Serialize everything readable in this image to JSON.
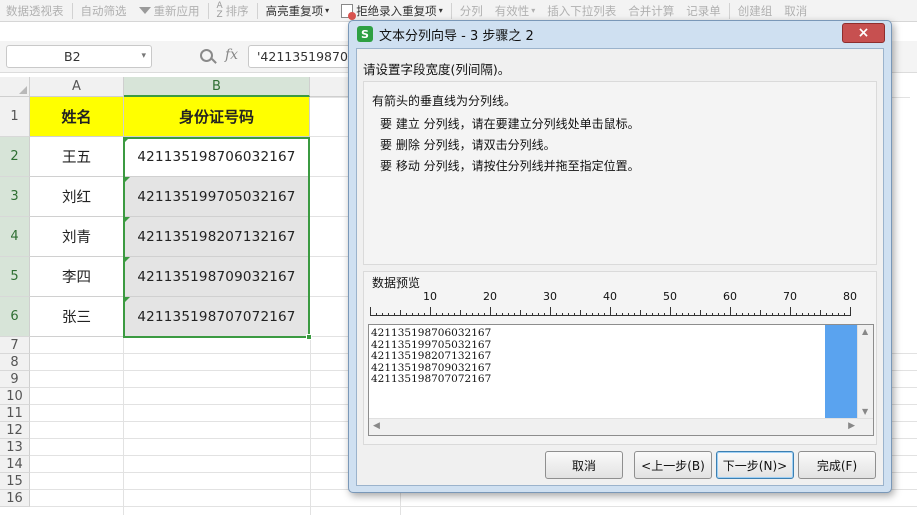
{
  "ribbon": {
    "items": [
      {
        "label": "数据透视表",
        "enabled": false
      },
      {
        "label": "自动筛选",
        "enabled": false
      },
      {
        "label": "重新应用",
        "enabled": false
      },
      {
        "label": "排序",
        "enabled": false
      },
      {
        "label": "高亮重复项",
        "enabled": true
      },
      {
        "label": "拒绝录入重复项",
        "enabled": true
      },
      {
        "label": "分列",
        "enabled": false
      },
      {
        "label": "有效性",
        "enabled": false
      },
      {
        "label": "插入下拉列表",
        "enabled": false
      },
      {
        "label": "合并计算",
        "enabled": false
      },
      {
        "label": "记录单",
        "enabled": false
      },
      {
        "label": "创建组",
        "enabled": false
      },
      {
        "label": "取消",
        "enabled": false
      }
    ]
  },
  "formula_bar": {
    "name_box": "B2",
    "fx": "fx",
    "value": "'42113519870"
  },
  "sheet": {
    "columns": [
      "A",
      "B"
    ],
    "selected_column": "B",
    "rows": [
      "1",
      "2",
      "3",
      "4",
      "5",
      "6",
      "7",
      "8",
      "9",
      "10",
      "11",
      "12",
      "13",
      "14",
      "15",
      "16"
    ],
    "header_name": "姓名",
    "header_id": "身份证号码",
    "records": [
      {
        "name": "王五",
        "id": "421135198706032167"
      },
      {
        "name": "刘红",
        "id": "421135199705032167"
      },
      {
        "name": "刘青",
        "id": "421135198207132167"
      },
      {
        "name": "李四",
        "id": "421135198709032167"
      },
      {
        "name": "张三",
        "id": "421135198707072167"
      }
    ]
  },
  "dialog": {
    "icon_letter": "S",
    "title": "文本分列向导 - 3 步骤之 2",
    "close": "×",
    "prompt": "请设置字段宽度(列间隔)。",
    "instructions": [
      "有箭头的垂直线为分列线。",
      "要 建立 分列线，请在要建立分列线处单击鼠标。",
      "要 删除 分列线，请双击分列线。",
      "要 移动 分列线，请按住分列线并拖至指定位置。"
    ],
    "preview_label": "数据预览",
    "ruler_labels": [
      "10",
      "20",
      "30",
      "40",
      "50",
      "60",
      "70",
      "80"
    ],
    "preview_lines": [
      "421135198706032167",
      "421135199705032167",
      "421135198207132167",
      "421135198709032167",
      "421135198707072167"
    ],
    "buttons": {
      "cancel": "取消",
      "prev": "<上一步(B)",
      "next": "下一步(N)>",
      "finish": "完成(F)"
    }
  }
}
